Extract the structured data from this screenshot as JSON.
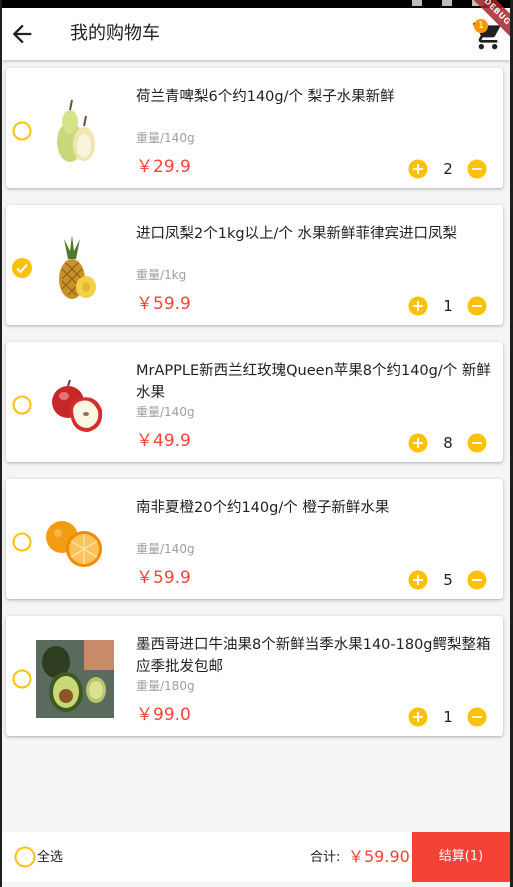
{
  "header": {
    "title": "我的购物车",
    "cart_count": "1",
    "debug_label": "DEBUG"
  },
  "items": [
    {
      "name": "荷兰青啤梨6个约140g/个 梨子水果新鲜",
      "weight": "重量/140g",
      "price": "￥29.9",
      "qty": "2",
      "checked": false,
      "thumb": "pear"
    },
    {
      "name": "进口凤梨2个1kg以上/个 水果新鲜菲律宾进口凤梨",
      "weight": "重量/1kg",
      "price": "￥59.9",
      "qty": "1",
      "checked": true,
      "thumb": "pineapple"
    },
    {
      "name": "MrAPPLE新西兰红玫瑰Queen苹果8个约140g/个 新鲜水果",
      "weight": "重量/140g",
      "price": "￥49.9",
      "qty": "8",
      "checked": false,
      "thumb": "apple"
    },
    {
      "name": "南非夏橙20个约140g/个 橙子新鲜水果",
      "weight": "重量/140g",
      "price": "￥59.9",
      "qty": "5",
      "checked": false,
      "thumb": "orange"
    },
    {
      "name": "墨西哥进口牛油果8个新鲜当季水果140-180g鳄梨整箱应季批发包邮",
      "weight": "重量/180g",
      "price": "￥99.0",
      "qty": "1",
      "checked": false,
      "thumb": "avocado"
    }
  ],
  "footer": {
    "select_all_label": "全选",
    "total_label": "合计:",
    "total_value": "￥59.90",
    "checkout_label": "结算(1)"
  },
  "colors": {
    "accent": "#ffc107",
    "price": "#f44336",
    "checkout": "#f44336"
  }
}
